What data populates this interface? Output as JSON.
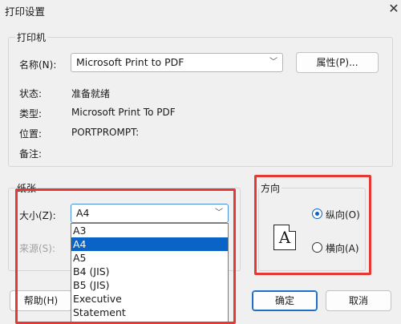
{
  "window": {
    "title": "打印设置"
  },
  "printer": {
    "legend": "打印机",
    "name_label": "名称(N):",
    "name_value": "Microsoft Print to PDF",
    "properties_button": "属性(P)...",
    "status_label": "状态:",
    "status_value": "准备就绪",
    "type_label": "类型:",
    "type_value": "Microsoft Print To PDF",
    "location_label": "位置:",
    "location_value": "PORTPROMPT:",
    "comment_label": "备注:",
    "comment_value": ""
  },
  "paper": {
    "legend": "纸张",
    "size_label": "大小(Z):",
    "size_value": "A4",
    "source_label": "来源(S):",
    "options": [
      "A3",
      "A4",
      "A5",
      "B4 (JIS)",
      "B5 (JIS)",
      "Executive",
      "Statement"
    ],
    "selected_option": "A4"
  },
  "orientation": {
    "legend": "方向",
    "portrait_label": "纵向(O)",
    "landscape_label": "横向(A)",
    "selected": "portrait",
    "icon_letter": "A"
  },
  "buttons": {
    "help": "帮助(H)",
    "ok": "确定",
    "cancel": "取消"
  },
  "highlight_color": "#e53935",
  "accent_color": "#0a64c8"
}
